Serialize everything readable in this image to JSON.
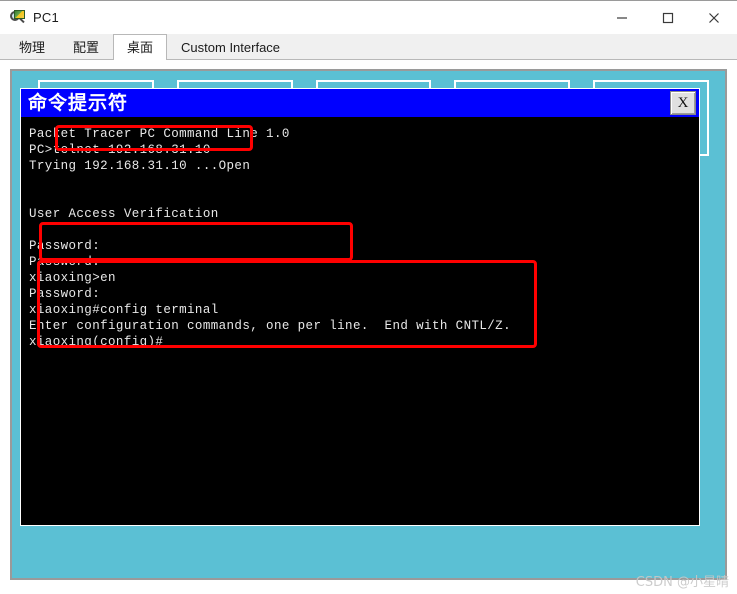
{
  "window": {
    "title": "PC1",
    "icon": "magnifier-pc-icon",
    "controls": {
      "minimize": "minimize-icon",
      "maximize": "maximize-icon",
      "close": "close-icon"
    }
  },
  "tabs": [
    {
      "label": "物理",
      "selected": false
    },
    {
      "label": "配置",
      "selected": false
    },
    {
      "label": "桌面",
      "selected": true
    },
    {
      "label": "Custom Interface",
      "selected": false
    }
  ],
  "desktop": {
    "background_color": "#5bc0d4",
    "icons": [
      {
        "name": "desktop-tile-1"
      },
      {
        "name": "desktop-tile-2"
      },
      {
        "name": "desktop-tile-3"
      },
      {
        "name": "desktop-tile-4"
      },
      {
        "name": "desktop-tile-5"
      }
    ]
  },
  "terminal": {
    "title": "命令提示符",
    "title_bar_color": "#0000ff",
    "close_button_label": "X",
    "background_color": "#000000",
    "text_color": "#e8e8e8",
    "lines": [
      "Packet Tracer PC Command Line 1.0",
      "PC>telnet 192.168.31.10",
      "Trying 192.168.31.10 ...Open",
      "",
      "",
      "User Access Verification",
      "",
      "Password:",
      "Password:",
      "xiaoxing>en",
      "Password:",
      "xiaoxing#config terminal",
      "Enter configuration commands, one per line.  End with CNTL/Z.",
      "xiaoxing(config)#"
    ]
  },
  "annotations": {
    "color": "#ff0000",
    "boxes": [
      {
        "name": "annotation-telnet-command",
        "target": "PC>telnet 192.168.31.10"
      },
      {
        "name": "annotation-password-prompts",
        "target": "Password: / Password:"
      },
      {
        "name": "annotation-config-session",
        "target": "xiaoxing>en ... xiaoxing(config)#"
      }
    ]
  },
  "watermark": {
    "text": "CSDN @小星晴"
  }
}
